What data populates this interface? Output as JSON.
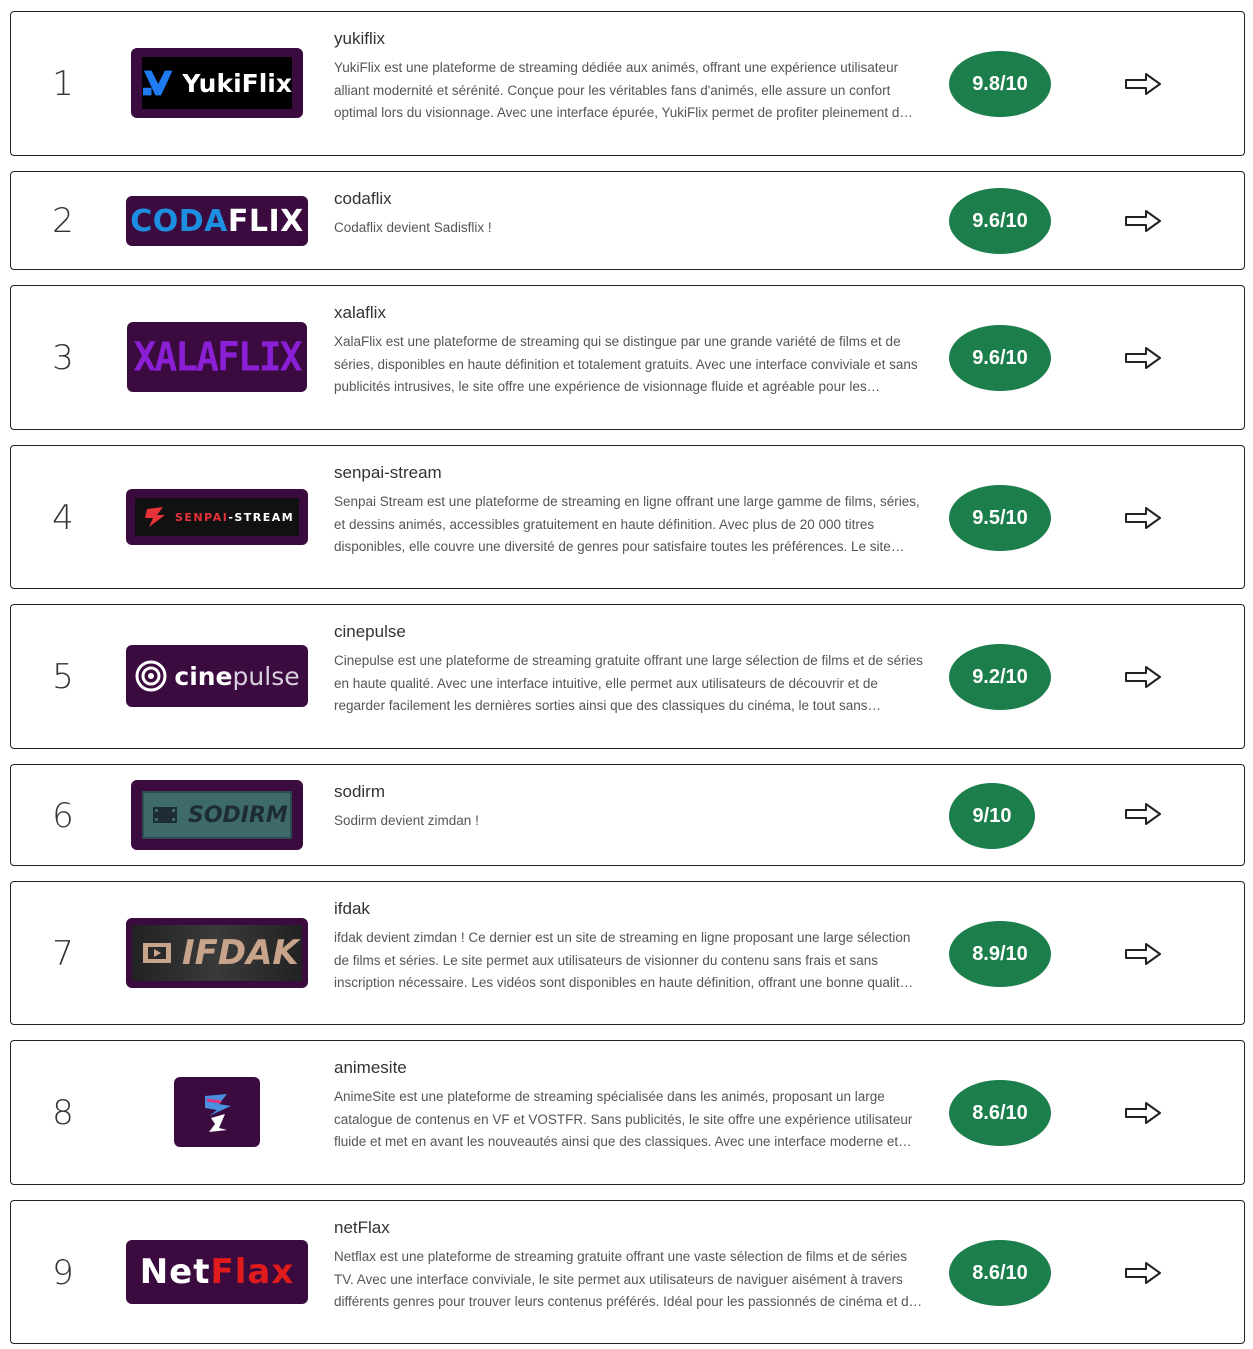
{
  "colors": {
    "score_bg": "#1b7e4b",
    "logo_bg": "#3b0a3f",
    "score_text": "#ffffff"
  },
  "items": [
    {
      "rank": "1",
      "name": "yukiflix",
      "logo_text": "YukiFlix",
      "score": "9.8/10",
      "description": "YukiFlix est une plateforme de streaming dédiée aux animés, offrant une expérience utilisateur alliant modernité et sérénité. Conçue pour les véritables fans d'animés, elle assure un confort optimal lors du visionnage. Avec une interface épurée, YukiFlix permet de profiter pleinement d…"
    },
    {
      "rank": "2",
      "name": "codaflix",
      "logo_text_a": "CODA",
      "logo_text_b": "FLIX",
      "score": "9.6/10",
      "description": "Codaflix devient Sadisflix !"
    },
    {
      "rank": "3",
      "name": "xalaflix",
      "logo_text": "XALAFLIX",
      "score": "9.6/10",
      "description": "XalaFlix est une plateforme de streaming qui se distingue par une grande variété de films et de séries, disponibles en haute définition et totalement gratuits. Avec une interface conviviale et sans publicités intrusives, le site offre une expérience de visionnage fluide et agréable pour les…"
    },
    {
      "rank": "4",
      "name": "senpai-stream",
      "logo_text_a": "SENPAI",
      "logo_text_b": "-STREAM",
      "score": "9.5/10",
      "description": "Senpai Stream est une plateforme de streaming en ligne offrant une large gamme de films, séries, et dessins animés, accessibles gratuitement en haute définition. Avec plus de 20 000 titres disponibles, elle couvre une diversité de genres pour satisfaire toutes les préférences. Le site…"
    },
    {
      "rank": "5",
      "name": "cinepulse",
      "logo_text_a": "cine",
      "logo_text_b": "pulse",
      "score": "9.2/10",
      "description": "Cinepulse est une plateforme de streaming gratuite offrant une large sélection de films et de séries en haute qualité. Avec une interface intuitive, elle permet aux utilisateurs de découvrir et de regarder facilement les dernières sorties ainsi que des classiques du cinéma, le tout sans…"
    },
    {
      "rank": "6",
      "name": "sodirm",
      "logo_text": "SODIRM",
      "score": "9/10",
      "description": "Sodirm devient zimdan !"
    },
    {
      "rank": "7",
      "name": "ifdak",
      "logo_text": "IFDAK",
      "score": "8.9/10",
      "description": "ifdak devient zimdan ! Ce dernier est un site de streaming en ligne proposant une large sélection de films et séries. Le site permet aux utilisateurs de visionner du contenu sans frais et sans inscription nécessaire. Les vidéos sont disponibles en haute définition, offrant une bonne qualit…"
    },
    {
      "rank": "8",
      "name": "animesite",
      "logo_text": "",
      "score": "8.6/10",
      "description": "AnimeSite est une plateforme de streaming spécialisée dans les animés, proposant un large catalogue de contenus en VF et VOSTFR. Sans publicités, le site offre une expérience utilisateur fluide et met en avant les nouveautés ainsi que des classiques. Avec une interface moderne et…"
    },
    {
      "rank": "9",
      "name": "netFlax",
      "logo_text_a": "Net",
      "logo_text_b": "Flax",
      "score": "8.6/10",
      "description": "Netflax est une plateforme de streaming gratuite offrant une vaste sélection de films et de séries TV. Avec une interface conviviale, le site permet aux utilisateurs de naviguer aisément à travers différents genres pour trouver leurs contenus préférés. Idéal pour les passionnés de cinéma et d…"
    }
  ]
}
